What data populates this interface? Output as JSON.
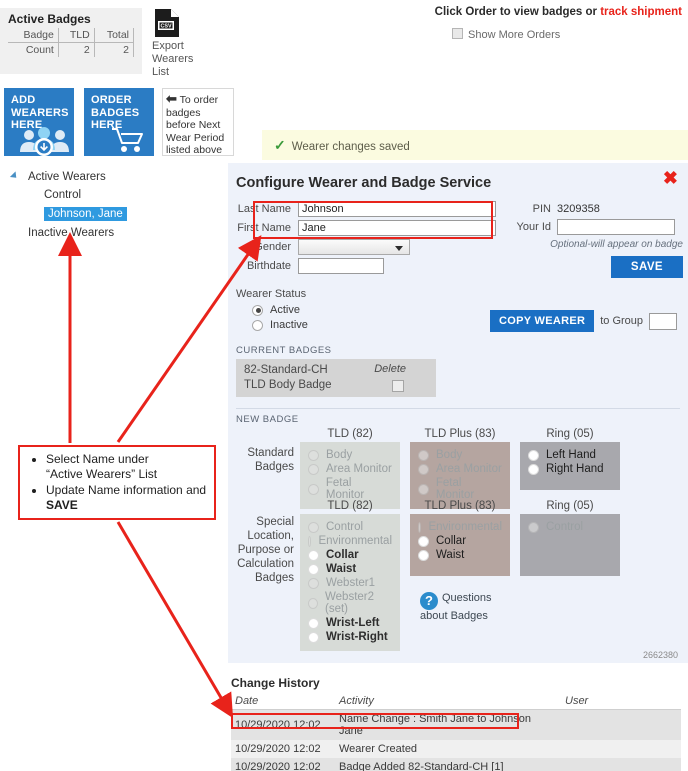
{
  "active_badges": {
    "title": "Active Badges",
    "headers": [
      "Badge",
      "TLD",
      "Total"
    ],
    "row": [
      "Count",
      "2",
      "2"
    ]
  },
  "export": {
    "icon": "csv-file-icon",
    "badge_text": "CSV",
    "label": "Export\nWearers\nList",
    "line1": "Export",
    "line2": "Wearers",
    "line3": "List"
  },
  "order_note": {
    "prefix": "Click Order to view badges or ",
    "link": "track shipment",
    "show_more": "Show More Orders"
  },
  "tiles": {
    "add_wearers": "ADD\nWEARERS\nHERE",
    "add_wearers_l1": "ADD",
    "add_wearers_l2": "WEARERS",
    "add_wearers_l3": "HERE",
    "order_badges_l1": "ORDER",
    "order_badges_l2": "BADGES",
    "order_badges_l3": "HERE",
    "note": "To order badges before Next Wear Period listed above"
  },
  "tree": {
    "active_wearers": "Active Wearers",
    "control": "Control",
    "selected_wearer": "Johnson, Jane",
    "inactive_wearers": "Inactive Wearers"
  },
  "notification": {
    "icon": "check-icon",
    "text": "Wearer changes saved"
  },
  "dialog": {
    "title": "Configure Wearer and Badge Service",
    "close_icon": "close-x-icon",
    "form": {
      "last_name_label": "Last Name",
      "last_name_value": "Johnson",
      "first_name_label": "First Name",
      "first_name_value": "Jane",
      "gender_label": "Gender",
      "gender_value": "",
      "birthdate_label": "Birthdate",
      "birthdate_value": ""
    },
    "right": {
      "pin_label": "PIN",
      "pin_value": "3209358",
      "your_id_label": "Your Id",
      "your_id_value": "",
      "hint": "Optional-will appear on badge",
      "save_label": "SAVE"
    },
    "wearer_status": {
      "title": "Wearer Status",
      "options": [
        {
          "label": "Active",
          "selected": true
        },
        {
          "label": "Inactive",
          "selected": false
        }
      ]
    },
    "copy": {
      "button_label": "COPY WEARER",
      "to_group_label": "to Group",
      "group_value": ""
    },
    "current_badges": {
      "title": "CURRENT BADGES",
      "badge_code": "82-Standard-CH",
      "badge_type": "TLD Body Badge",
      "delete_label": "Delete",
      "delete_checked": false
    },
    "new_badge": {
      "title": "NEW BADGE",
      "columns": [
        "TLD (82)",
        "TLD Plus (83)",
        "Ring (05)"
      ],
      "rows": [
        {
          "label": "Standard Badges",
          "label_lines": [
            "Standard",
            "Badges"
          ],
          "groups": [
            {
              "column": "TLD (82)",
              "theme": "tld",
              "options": [
                {
                  "label": "Body",
                  "enabled": false
                },
                {
                  "label": "Area Monitor",
                  "enabled": false
                },
                {
                  "label": "Fetal Monitor",
                  "enabled": false
                }
              ]
            },
            {
              "column": "TLD Plus (83)",
              "theme": "plus",
              "options": [
                {
                  "label": "Body",
                  "enabled": false
                },
                {
                  "label": "Area Monitor",
                  "enabled": false
                },
                {
                  "label": "Fetal Monitor",
                  "enabled": false
                }
              ]
            },
            {
              "column": "Ring (05)",
              "theme": "ring",
              "options": [
                {
                  "label": "Left Hand",
                  "enabled": true
                },
                {
                  "label": "Right Hand",
                  "enabled": true
                }
              ]
            }
          ]
        },
        {
          "label": "Special Location, Purpose or Calculation Badges",
          "label_lines": [
            "Special",
            "Location,",
            "Purpose or",
            "Calculation",
            "Badges"
          ],
          "groups": [
            {
              "column": "TLD (82)",
              "theme": "tld",
              "options": [
                {
                  "label": "Control",
                  "enabled": false
                },
                {
                  "label": "Environmental",
                  "enabled": false
                },
                {
                  "label": "Collar",
                  "enabled": true
                },
                {
                  "label": "Waist",
                  "enabled": true
                },
                {
                  "label": "Webster1",
                  "enabled": false
                },
                {
                  "label": "Webster2 (set)",
                  "enabled": false
                },
                {
                  "label": "Wrist-Left",
                  "enabled": true
                },
                {
                  "label": "Wrist-Right",
                  "enabled": true
                }
              ]
            },
            {
              "column": "TLD Plus (83)",
              "theme": "plus",
              "options": [
                {
                  "label": "Environmental",
                  "enabled": false
                },
                {
                  "label": "Collar",
                  "enabled": true
                },
                {
                  "label": "Waist",
                  "enabled": true
                }
              ]
            },
            {
              "column": "Ring (05)",
              "theme": "ring",
              "options": [
                {
                  "label": "Control",
                  "enabled": false
                }
              ]
            }
          ]
        }
      ]
    },
    "questions": {
      "icon": "question-mark-icon",
      "line1": "Questions",
      "line2": "about Badges"
    },
    "reference_id": "2662380"
  },
  "change_history": {
    "title": "Change History",
    "headers": [
      "Date",
      "Activity",
      "User"
    ],
    "rows": [
      {
        "date": "10/29/2020 12:02",
        "activity": "Name Change : Smith Jane to Johnson Jane",
        "user": ""
      },
      {
        "date": "10/29/2020 12:02",
        "activity": "Wearer Created",
        "user": ""
      },
      {
        "date": "10/29/2020 12:02",
        "activity": "Badge Added 82-Standard-CH [1]",
        "user": ""
      }
    ]
  },
  "callout": {
    "bullet1_a": "Select Name under ",
    "bullet1_b": "“Active Wearers” List",
    "bullet2_a": "Update Name information and ",
    "bullet2_b": "SAVE"
  },
  "colors": {
    "accent_blue": "#1a6fc4",
    "tile_blue": "#2b7cc4",
    "annotation_red": "#e8231b",
    "dialog_bg": "#eef2fa",
    "panel_tld": "#d7dbd7",
    "panel_plus": "#b5a5a0",
    "panel_ring": "#a8a8ad",
    "notify_bg": "#fbfbe0",
    "select_blue": "#2f9ae0"
  }
}
